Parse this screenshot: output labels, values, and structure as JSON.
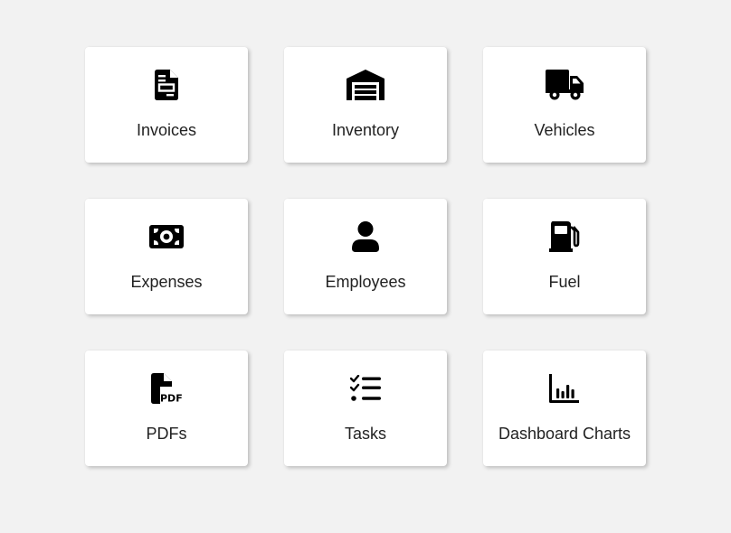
{
  "tiles": [
    {
      "label": "Invoices",
      "icon": "invoice-icon"
    },
    {
      "label": "Inventory",
      "icon": "warehouse-icon"
    },
    {
      "label": "Vehicles",
      "icon": "truck-icon"
    },
    {
      "label": "Expenses",
      "icon": "money-bill-icon"
    },
    {
      "label": "Employees",
      "icon": "user-icon"
    },
    {
      "label": "Fuel",
      "icon": "gas-pump-icon"
    },
    {
      "label": "PDFs",
      "icon": "pdf-file-icon"
    },
    {
      "label": "Tasks",
      "icon": "task-list-icon"
    },
    {
      "label": "Dashboard Charts",
      "icon": "bar-chart-icon"
    }
  ],
  "colors": {
    "background": "#f2f2f2",
    "tile": "#ffffff",
    "icon": "#000000",
    "text": "#222222"
  }
}
